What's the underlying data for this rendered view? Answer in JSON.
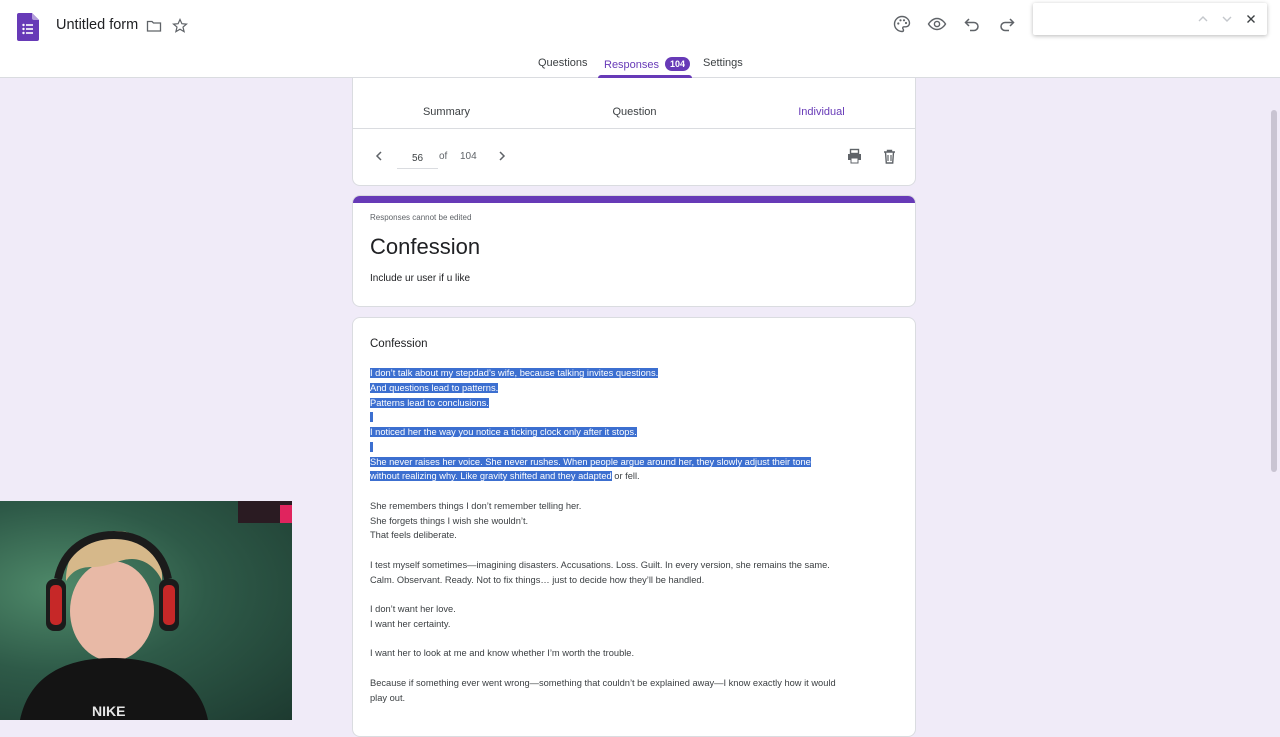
{
  "header": {
    "doc_title": "Untitled form",
    "tabs": [
      {
        "label": "Questions"
      },
      {
        "label": "Responses",
        "badge": "104"
      },
      {
        "label": "Settings"
      }
    ],
    "active_tab": "Responses",
    "icons": [
      "forms-logo-icon",
      "folder-icon",
      "star-icon",
      "palette-icon",
      "preview-eye-icon",
      "undo-icon",
      "redo-icon"
    ]
  },
  "find_bar": {
    "value": "",
    "icons": [
      "chevron-up-icon",
      "chevron-down-icon",
      "close-icon"
    ]
  },
  "responses": {
    "subtabs": [
      "Summary",
      "Question",
      "Individual"
    ],
    "active_subtab": "Individual",
    "current": "56",
    "of_label": "of",
    "total": "104",
    "icons": [
      "chevron-left-icon",
      "chevron-right-icon",
      "print-icon",
      "delete-icon"
    ]
  },
  "form": {
    "note": "Responses cannot be edited",
    "title": "Confession",
    "description": "Include ur user if u like",
    "accent_color": "#673ab7"
  },
  "question": {
    "title": "Confession",
    "answer_lines": [
      {
        "text": "I don’t talk about my stepdad’s wife, because talking invites questions.",
        "selected": true
      },
      {
        "text": "And questions lead to patterns.",
        "selected": true
      },
      {
        "text": "Patterns lead to conclusions.",
        "selected": true
      },
      {
        "text": "",
        "selected": true
      },
      {
        "text": "I noticed her the way you notice a ticking clock only after it stops.",
        "selected": true
      },
      {
        "text": "",
        "selected": true
      },
      {
        "text": "She never raises her voice. She never rushes. When people argue around her, they slowly adjust their tone",
        "selected": true
      },
      {
        "text": "without realizing why. Like gravity shifted and they adapted",
        "tail": " or fell.",
        "selected": true
      },
      {
        "text": "",
        "selected": false
      },
      {
        "text": "She remembers things I don’t remember telling her.",
        "selected": false
      },
      {
        "text": "She forgets things I wish she wouldn’t.",
        "selected": false
      },
      {
        "text": "That feels deliberate.",
        "selected": false
      },
      {
        "text": "",
        "selected": false
      },
      {
        "text": "I test myself sometimes—imagining disasters. Accusations. Loss. Guilt. In every version, she remains the same.",
        "selected": false
      },
      {
        "text": "Calm. Observant. Ready. Not to fix things… just to decide how they’ll be handled.",
        "selected": false
      },
      {
        "text": "",
        "selected": false
      },
      {
        "text": "I don’t want her love.",
        "selected": false
      },
      {
        "text": "I want her certainty.",
        "selected": false
      },
      {
        "text": "",
        "selected": false
      },
      {
        "text": "I want her to look at me and know whether I’m worth the trouble.",
        "selected": false
      },
      {
        "text": "",
        "selected": false
      },
      {
        "text": "Because if something ever went wrong—something that couldn’t be explained away—I know exactly how it would",
        "selected": false
      },
      {
        "text": "play out.",
        "selected": false
      }
    ],
    "selection_color": "#3c6fd0"
  },
  "overlay": {
    "webcam": "webcam-feed",
    "shirt_text": "NIKE"
  }
}
